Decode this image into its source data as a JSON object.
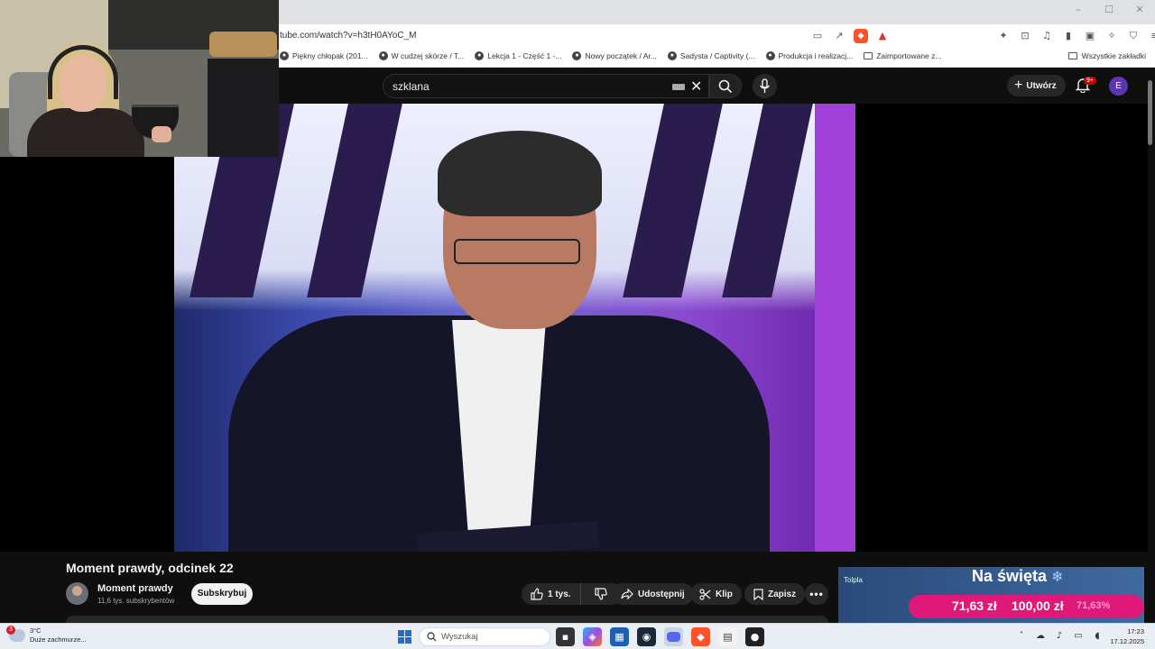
{
  "browser": {
    "url": "tube.com/watch?v=h3tH0AYoC_M",
    "window_controls": [
      "–",
      "☐",
      "✕"
    ],
    "bookmarks": [
      {
        "label": "Piękny chłopak (201...",
        "icon": "tab-icon"
      },
      {
        "label": "W cudzej skórze / T...",
        "icon": "tab-icon"
      },
      {
        "label": "Lekcja 1 - Część 1 -...",
        "icon": "tab-icon"
      },
      {
        "label": "Nowy początek / Ar...",
        "icon": "tab-icon"
      },
      {
        "label": "Sadysta / Captivity (...",
        "icon": "tab-icon"
      },
      {
        "label": "Produkcja i realizacj...",
        "icon": "tab-icon"
      },
      {
        "label": "Zaimportowane z...",
        "icon": "folder-icon"
      }
    ],
    "all_bookmarks": "Wszystkie zakładki",
    "accent_color": "#fb542b"
  },
  "youtube": {
    "search_value": "szklana",
    "create_label": "Utwórz",
    "notification_count": "9+",
    "avatar_letter": "E",
    "avatar_color": "#5e35b1"
  },
  "video": {
    "title": "Moment prawdy, odcinek 22",
    "channel_name": "Moment prawdy",
    "subscribers": "11,6 tys. subskrybentów",
    "subscribe_label": "Subskrybuj",
    "likes": "1 tys.",
    "share_label": "Udostępnij",
    "clip_label": "Klip",
    "save_label": "Zapisz"
  },
  "ad": {
    "thumb_text": "Tolpla",
    "title": "Na święta",
    "price_new": "71,63 zł",
    "price_old": "100,00 zł",
    "discount": "71,63%",
    "bar_color": "#e0187a"
  },
  "taskbar": {
    "weather_temp": "3°C",
    "weather_desc": "Duże zachmurze...",
    "weather_badge": "3",
    "search_placeholder": "Wyszukaj",
    "time": "17:23",
    "date": "17.12.2025"
  }
}
